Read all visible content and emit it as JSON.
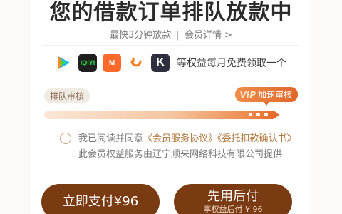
{
  "header": {
    "title": "您的借款订单排队放款中",
    "subtitle_fast": "最快3分钟放款",
    "subtitle_sep": "|",
    "subtitle_link": "会员详情 >"
  },
  "benefits": {
    "icons": [
      "tencent-video-icon",
      "iqiyi-icon",
      "mango-tv-icon",
      "didi-icon",
      "kuaikan-icon"
    ],
    "iqiyi_glyph": "iQIYI",
    "mango_glyph": "M",
    "kuaikan_glyph": "K",
    "text": "等权益每月免费领取一个"
  },
  "queue": {
    "normal_label": "排队审核",
    "vip_badge": "VIP",
    "vip_label": "加速审核"
  },
  "agreement": {
    "prefix": "我已阅读并同意",
    "link1": "《会员服务协议》",
    "link2": "《委托扣款确认书》",
    "suffix": "此会员权益服务由辽宁顺来网络科技有限公司提供"
  },
  "actions": {
    "pay_label": "立即支付¥96",
    "later_label": "先用后付",
    "later_sub": "享权益后付 ¥ 96"
  },
  "colors": {
    "accent": "#7a3a12",
    "link": "#b0763c",
    "vip": "#e4702f"
  }
}
